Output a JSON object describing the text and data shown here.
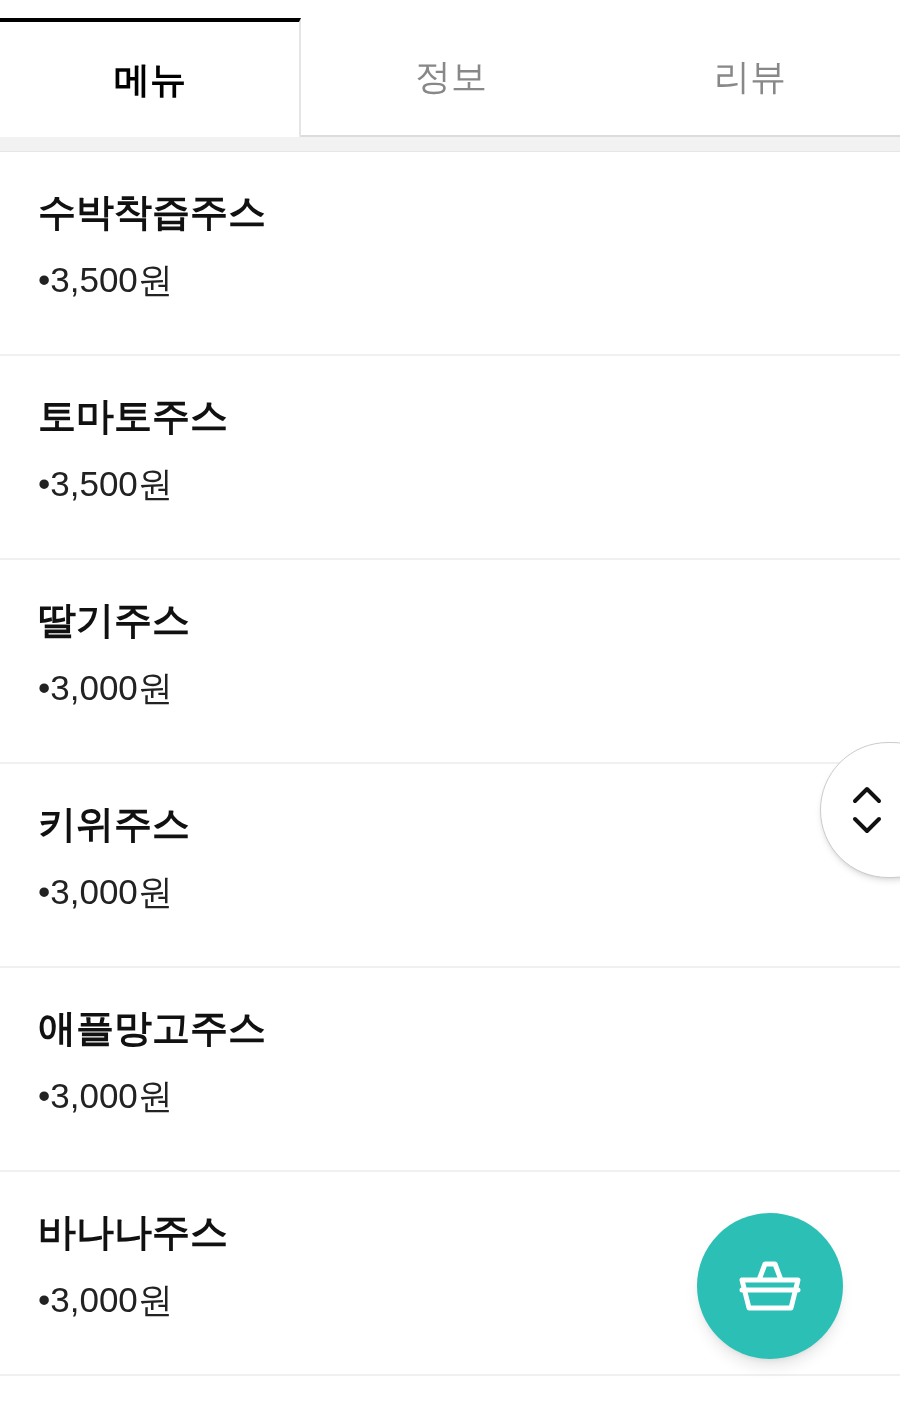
{
  "tabs": [
    {
      "label": "메뉴",
      "selected": true
    },
    {
      "label": "정보",
      "selected": false
    },
    {
      "label": "리뷰",
      "selected": false
    }
  ],
  "menu_items": [
    {
      "name": "수박착즙주스",
      "price": "•3,500원"
    },
    {
      "name": "토마토주스",
      "price": "•3,500원"
    },
    {
      "name": "딸기주스",
      "price": "•3,000원"
    },
    {
      "name": "키위주스",
      "price": "•3,000원"
    },
    {
      "name": "애플망고주스",
      "price": "•3,000원"
    },
    {
      "name": "바나나주스",
      "price": "•3,000원"
    }
  ]
}
